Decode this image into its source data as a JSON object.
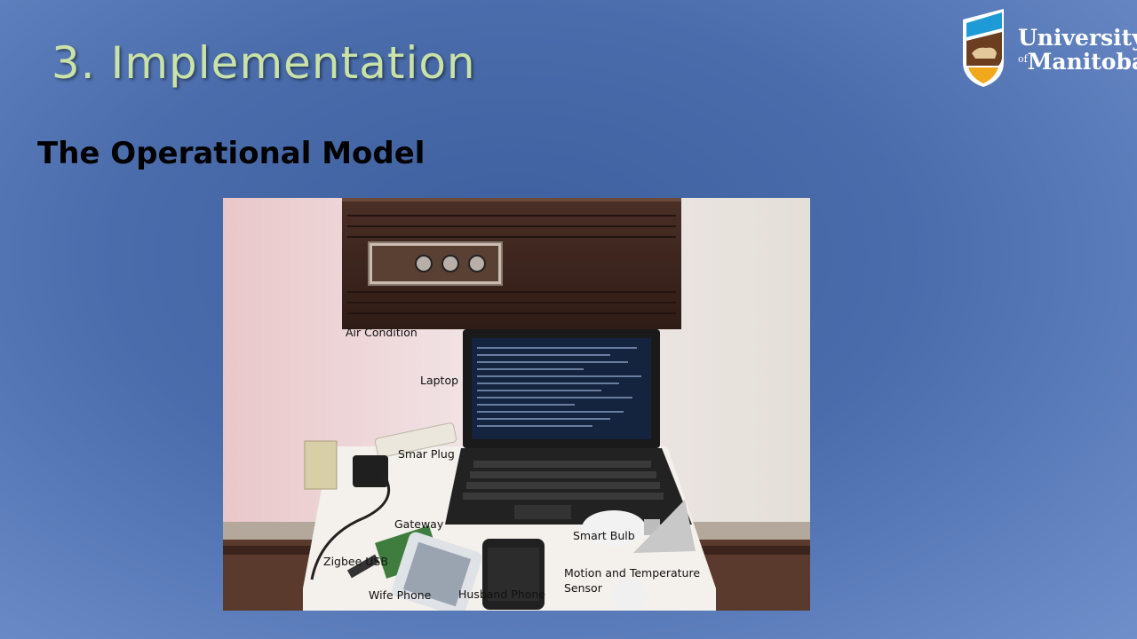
{
  "slide": {
    "title": "3. Implementation",
    "subtitle": "The Operational Model"
  },
  "logo": {
    "line1": "University",
    "of": "of",
    "line2": "Manitoba"
  },
  "photo_labels": {
    "air_condition": "Air Condition",
    "laptop": "Laptop",
    "smart_plug": "Smar Plug",
    "gateway": "Gateway",
    "zigbee_usb": "Zigbee USB",
    "smart_bulb": "Smart Bulb",
    "motion_sensor": "Motion and Temperature Sensor",
    "wife_phone": "Wife Phone",
    "husband_phone": "Husband Phone"
  },
  "colors": {
    "background": "#4a6cab",
    "title": "#c9e2a8",
    "logo_gold": "#f2a81d",
    "logo_blue": "#1e9ad6",
    "logo_brown": "#6b3e1f"
  }
}
